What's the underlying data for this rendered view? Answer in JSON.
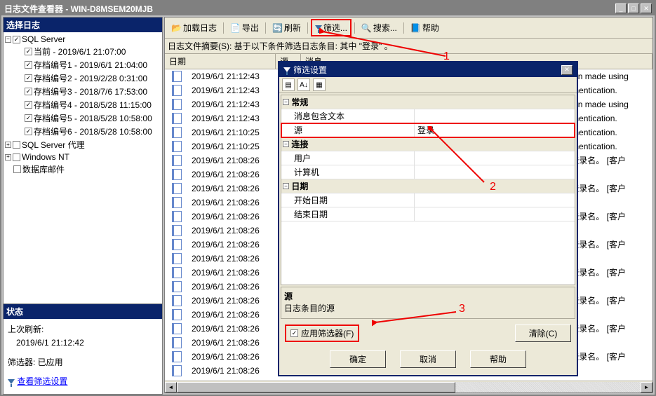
{
  "app": {
    "title": "日志文件查看器 - WIN-D8MSEM20MJB"
  },
  "left": {
    "header": "选择日志",
    "root": "SQL Server",
    "items": [
      "当前 - 2019/6/1 21:07:00",
      "存档编号1 - 2019/6/1 21:04:00",
      "存档编号2 - 2019/2/28 0:31:00",
      "存档编号3 - 2018/7/6 17:53:00",
      "存档编号4 - 2018/5/28 11:15:00",
      "存档编号5 - 2018/5/28 10:58:00",
      "存档编号6 - 2018/5/28 10:58:00"
    ],
    "agent": "SQL Server 代理",
    "winnt": "Windows NT",
    "dbmail": "数据库邮件",
    "status_header": "状态",
    "last_refresh_label": "上次刷新:",
    "last_refresh_value": "2019/6/1 21:12:42",
    "filter_label": "筛选器: 已应用",
    "filter_link": "查看筛选设置"
  },
  "toolbar": {
    "load": "加载日志",
    "export": "导出",
    "refresh": "刷新",
    "filter": "筛选...",
    "search": "搜索...",
    "help": "帮助"
  },
  "summary": {
    "prefix": "日志文件摘要(S): 基于以下条件筛选日志条目: 其中",
    "term": "\"登录\"",
    "suffix": "。"
  },
  "table": {
    "col_date": "日期",
    "col_src": "源",
    "col_msg": "消息",
    "rows": [
      {
        "date": "2019/6/1 21:12:43",
        "msg": ". Connection made using"
      },
      {
        "date": "2019/6/1 21:12:43",
        "msg": "Server authentication."
      },
      {
        "date": "2019/6/1 21:12:43",
        "msg": ". Connection made using"
      },
      {
        "date": "2019/6/1 21:12:43",
        "msg": "Server authentication."
      },
      {
        "date": "2019/6/1 21:10:25",
        "msg": "Server authentication."
      },
      {
        "date": "2019/6/1 21:10:25",
        "msg": "Server authentication."
      },
      {
        "date": "2019/6/1 21:08:26",
        "msg": "'相匹配的登录名。 [客户"
      },
      {
        "date": "2019/6/1 21:08:26",
        "msg": ""
      },
      {
        "date": "2019/6/1 21:08:26",
        "msg": "'相匹配的登录名。 [客户"
      },
      {
        "date": "2019/6/1 21:08:26",
        "msg": ""
      },
      {
        "date": "2019/6/1 21:08:26",
        "msg": "'相匹配的登录名。 [客户"
      },
      {
        "date": "2019/6/1 21:08:26",
        "msg": ""
      },
      {
        "date": "2019/6/1 21:08:26",
        "msg": "'相匹配的登录名。 [客户"
      },
      {
        "date": "2019/6/1 21:08:26",
        "msg": ""
      },
      {
        "date": "2019/6/1 21:08:26",
        "msg": "'相匹配的登录名。 [客户"
      },
      {
        "date": "2019/6/1 21:08:26",
        "msg": ""
      },
      {
        "date": "2019/6/1 21:08:26",
        "msg": "'相匹配的登录名。 [客户"
      },
      {
        "date": "2019/6/1 21:08:26",
        "msg": ""
      },
      {
        "date": "2019/6/1 21:08:26",
        "msg": "'相匹配的登录名。 [客户"
      },
      {
        "date": "2019/6/1 21:08:26",
        "msg": ""
      },
      {
        "date": "2019/6/1 21:08:26",
        "msg": "'相匹配的登录名。 [客户"
      },
      {
        "date": "2019/6/1 21:08:26",
        "msg": ""
      }
    ]
  },
  "dialog": {
    "title": "筛选设置",
    "sec_general": "常规",
    "sec_conn": "连接",
    "sec_date": "日期",
    "lbl_msgcontains": "消息包含文本",
    "lbl_source": "源",
    "val_source": "登录",
    "lbl_user": "用户",
    "lbl_computer": "计算机",
    "lbl_startdate": "开始日期",
    "lbl_enddate": "结束日期",
    "desc_title": "源",
    "desc_text": "日志条目的源",
    "apply": "应用筛选器(F)",
    "clear": "清除(C)",
    "ok": "确定",
    "cancel": "取消",
    "help": "帮助"
  },
  "anno": {
    "n1": "1",
    "n2": "2",
    "n3": "3"
  }
}
